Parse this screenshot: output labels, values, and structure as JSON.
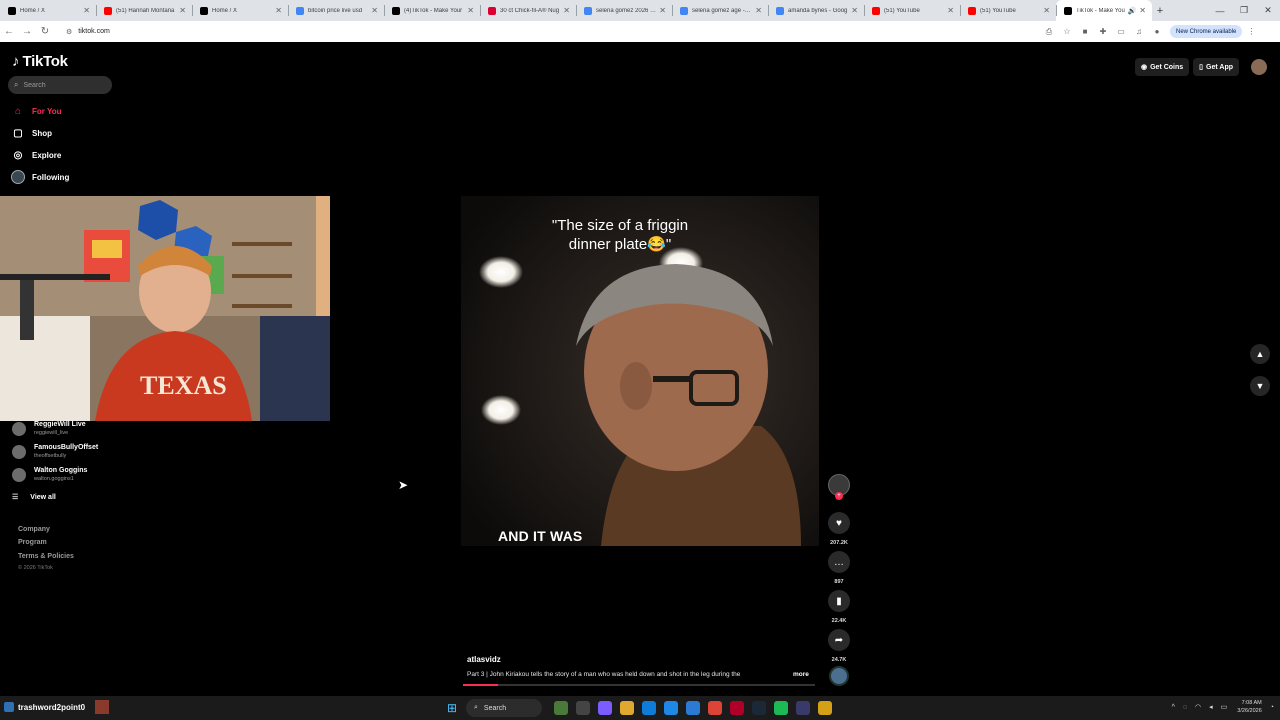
{
  "browser": {
    "tabs": [
      {
        "title": "Home / X",
        "favicon": "x-icon",
        "color": "#000000"
      },
      {
        "title": "(51) Hannah Montana",
        "favicon": "youtube-icon",
        "color": "#ff0000"
      },
      {
        "title": "Home / X",
        "favicon": "x-icon",
        "color": "#000000"
      },
      {
        "title": "bitcoin price live usd",
        "favicon": "google-icon",
        "color": "#4285f4"
      },
      {
        "title": "(4)TikTok - Make Your",
        "favicon": "tiktok-icon",
        "color": "#000000"
      },
      {
        "title": "30 ct Chick-fil-A® Nug",
        "favicon": "chickfila-icon",
        "color": "#dd0031"
      },
      {
        "title": "selena gomez 2026 - G",
        "favicon": "google-icon",
        "color": "#4285f4"
      },
      {
        "title": "selena gomez age - Go",
        "favicon": "google-icon",
        "color": "#4285f4"
      },
      {
        "title": "amanda bynes - Goog",
        "favicon": "google-icon",
        "color": "#4285f4"
      },
      {
        "title": "(51) YouTube",
        "favicon": "youtube-icon",
        "color": "#ff0000"
      },
      {
        "title": "(51) YouTube",
        "favicon": "youtube-icon",
        "color": "#ff0000"
      },
      {
        "title": "TikTok - Make You",
        "favicon": "tiktok-icon",
        "color": "#000000",
        "active": true
      }
    ],
    "url": "tiktok.com",
    "update_label": "New Chrome available"
  },
  "tiktok": {
    "logo": "TikTok",
    "search_placeholder": "Search",
    "nav": [
      {
        "label": "For You",
        "icon": "home-icon"
      },
      {
        "label": "Shop",
        "icon": "shop-icon"
      },
      {
        "label": "Explore",
        "icon": "compass-icon"
      },
      {
        "label": "Following",
        "icon": "following-icon"
      }
    ],
    "following_accounts": [
      {
        "name": "ReggieWill Live",
        "handle": "reggiewill_live"
      },
      {
        "name": "FamousBullyOffset",
        "handle": "theoffsetbully"
      },
      {
        "name": "Walton Goggins",
        "handle": "walton.goggins1"
      }
    ],
    "view_all": "View all",
    "footer": [
      "Company",
      "Program",
      "Terms & Policies"
    ],
    "copyright": "© 2026 TikTok",
    "header_buttons": {
      "coins": "Get Coins",
      "app": "Get App"
    },
    "video": {
      "caption_line1": "\"The size of a friggin",
      "caption_line2": "dinner plate😂\"",
      "subtitle": "AND IT WAS",
      "username": "atlasvidz",
      "description": "Part 3 | John Kiriakou tells the story of a man who was held down and shot in the leg during the",
      "more": "more",
      "progress": 0.1
    },
    "actions": {
      "likes": "207.2K",
      "comments": "897",
      "saves": "22.4K",
      "shares": "24.7K"
    }
  },
  "taskbar": {
    "user_label": "trashword2point0",
    "search_label": "Search",
    "time": "7:08 AM",
    "date": "3/26/2026"
  }
}
